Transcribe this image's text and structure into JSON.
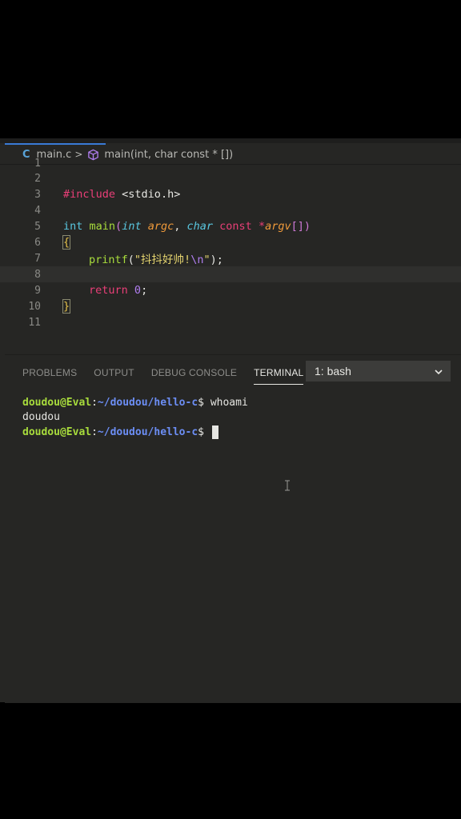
{
  "breadcrumb": {
    "file_icon": "C",
    "file": "main.c",
    "separator": ">",
    "symbol_icon": "cube-icon",
    "symbol": "main(int, char const * [])"
  },
  "code": {
    "line_numbers": [
      "1",
      "2",
      "3",
      "4",
      "5",
      "6",
      "7",
      "8",
      "9",
      "10",
      "11"
    ],
    "l3": {
      "directive": "#include",
      "header": "<stdio.h>"
    },
    "l5": {
      "ret_type": "int",
      "fname": "main",
      "open": "(",
      "p1_type": "int",
      "p1_name": "argc",
      "comma": ",",
      "p2_type": "char",
      "p2_const": "const",
      "star": "*",
      "p2_name": "argv",
      "brackets": "[]",
      "close": ")"
    },
    "l6": "{",
    "l7": {
      "call": "printf",
      "open": "(",
      "str_open": "\"抖抖好帅!",
      "escape": "\\n",
      "str_close": "\"",
      "end": ");"
    },
    "l9": {
      "kw": "return",
      "value": "0",
      "end": ";"
    },
    "l10": "}"
  },
  "panel": {
    "tabs": [
      "PROBLEMS",
      "OUTPUT",
      "DEBUG CONSOLE",
      "TERMINAL"
    ],
    "active_tab": "TERMINAL",
    "terminal_select": "1: bash"
  },
  "terminal": {
    "line1": {
      "user": "doudou@Eval",
      "sep": ":",
      "path": "~/doudou/hello-c",
      "prompt": "$ ",
      "cmd": "whoami"
    },
    "line2": "doudou",
    "line3": {
      "user": "doudou@Eval",
      "sep": ":",
      "path": "~/doudou/hello-c",
      "prompt": "$ "
    }
  },
  "colors": {
    "accent": "#3a7ad6",
    "keyword": "#ea3f78",
    "type": "#59c7e0",
    "function": "#a8dc3c",
    "parameter": "#f09a3a",
    "string": "#e6d56f",
    "number": "#b07ef0",
    "prompt_user": "#a8dc3c",
    "prompt_path": "#6c8ef5"
  }
}
